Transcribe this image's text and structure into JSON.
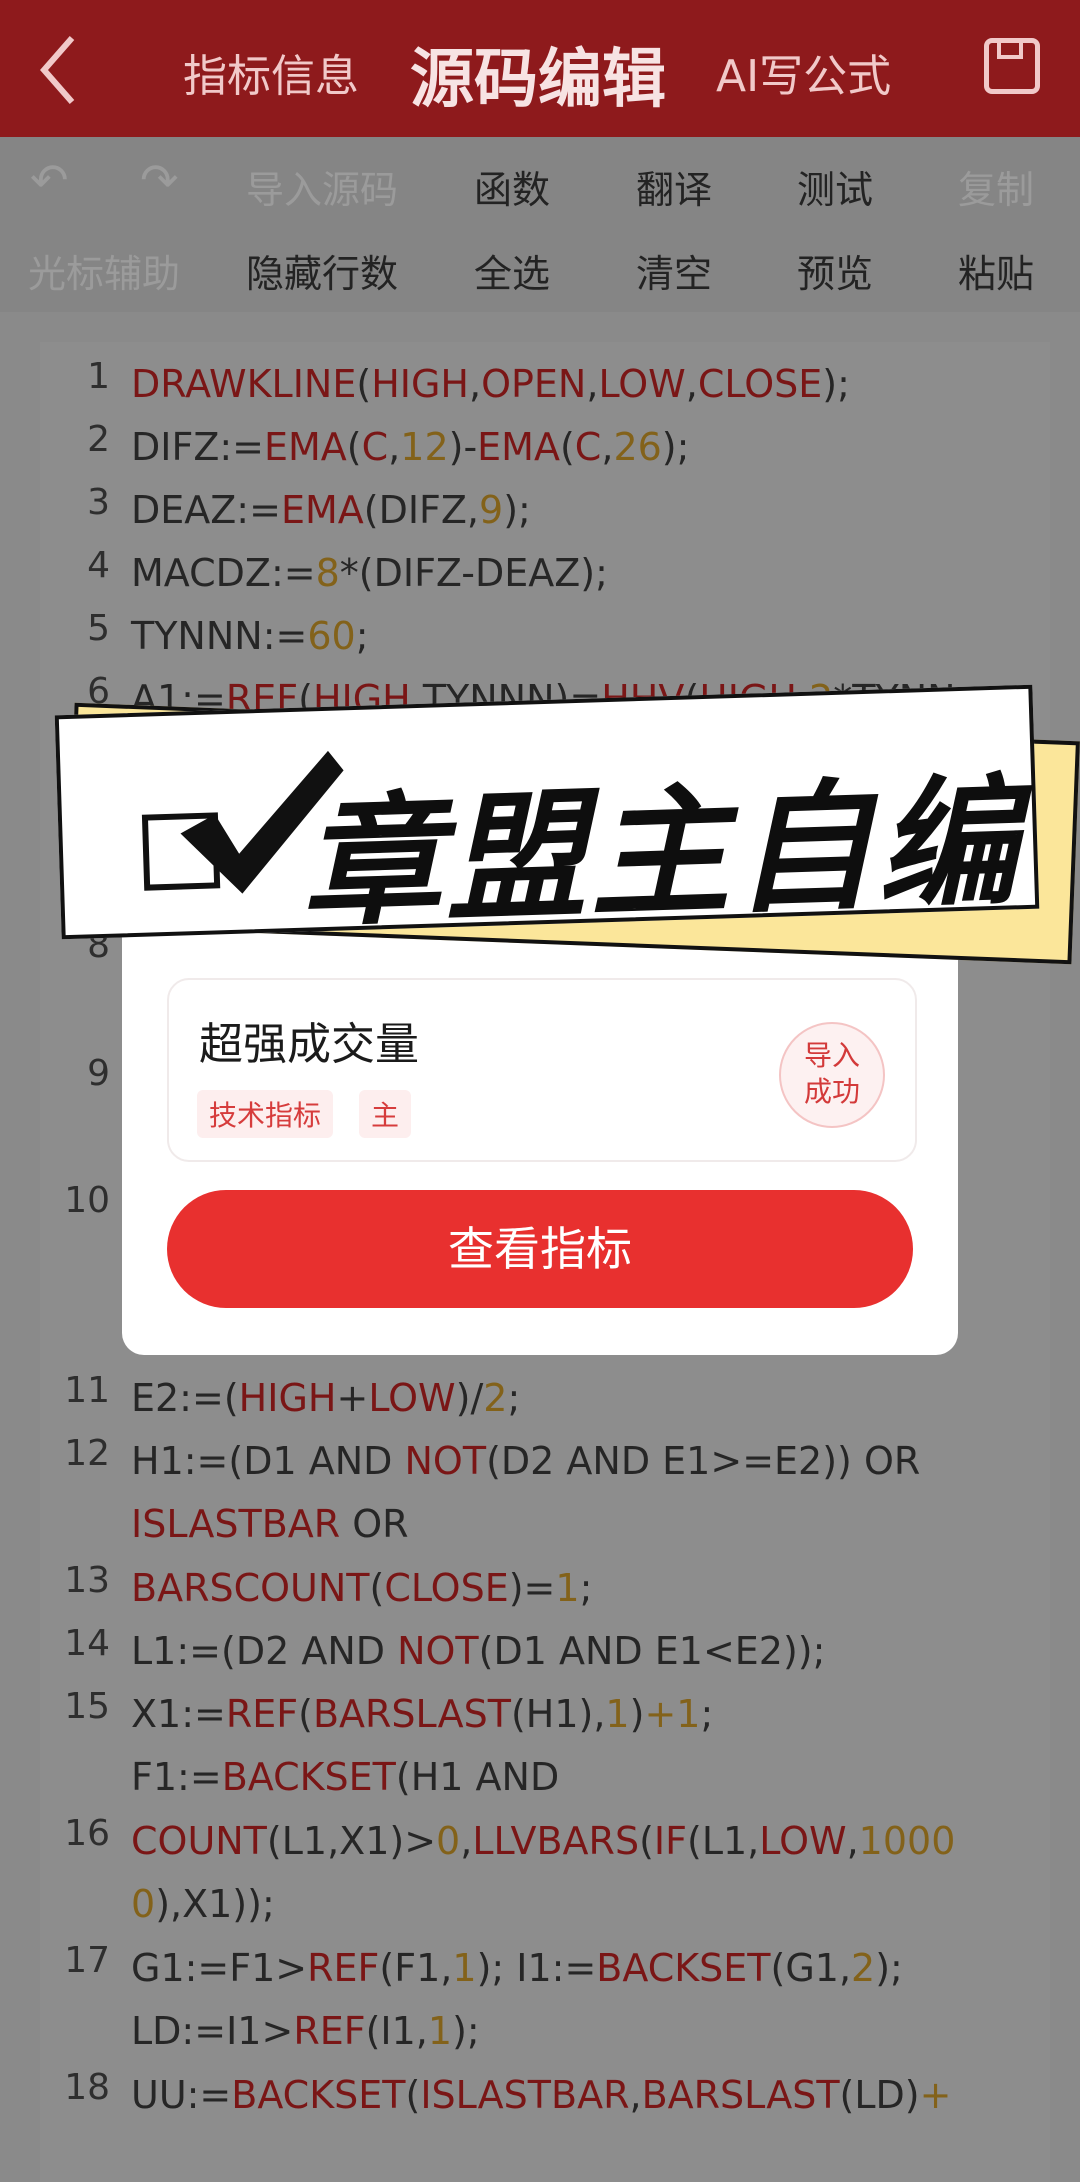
{
  "header": {
    "tabs": [
      {
        "label": "指标信息",
        "active": false
      },
      {
        "label": "源码编辑",
        "active": true
      },
      {
        "label": "AI写公式",
        "active": false
      }
    ],
    "back_icon": "chevron-left-icon",
    "save_icon": "save-icon"
  },
  "toolbar": {
    "row1": [
      "undo",
      "redo",
      "导入源码",
      "函数",
      "翻译",
      "测试",
      "复制"
    ],
    "row2": [
      "光标辅助",
      "隐藏行数",
      "全选",
      "清空",
      "预览",
      "粘贴"
    ]
  },
  "code_lines": {
    "l1": "1",
    "l2": "2",
    "l3": "3",
    "l4": "4",
    "l5": "5",
    "l6": "6",
    "l8": "8",
    "l9": "9",
    "l10": "10",
    "l11": "11",
    "l12": "12",
    "l13": "13",
    "l14": "14",
    "l15": "15",
    "l16": "16",
    "l17": "17",
    "l18": "18"
  },
  "dialog": {
    "indicator_name": "超强成交量",
    "tags": [
      "技术指标",
      "主"
    ],
    "stamp": "导入成功",
    "stamp_line1": "导入",
    "stamp_line2": "成功",
    "button": "查看指标"
  },
  "banner": {
    "text": "章盟主自编",
    "icon": "checkbox-check-icon"
  },
  "colors": {
    "header_bg": "#8e1a1c",
    "button_red": "#e8302f",
    "banner_yellow": "#fbe69a"
  }
}
